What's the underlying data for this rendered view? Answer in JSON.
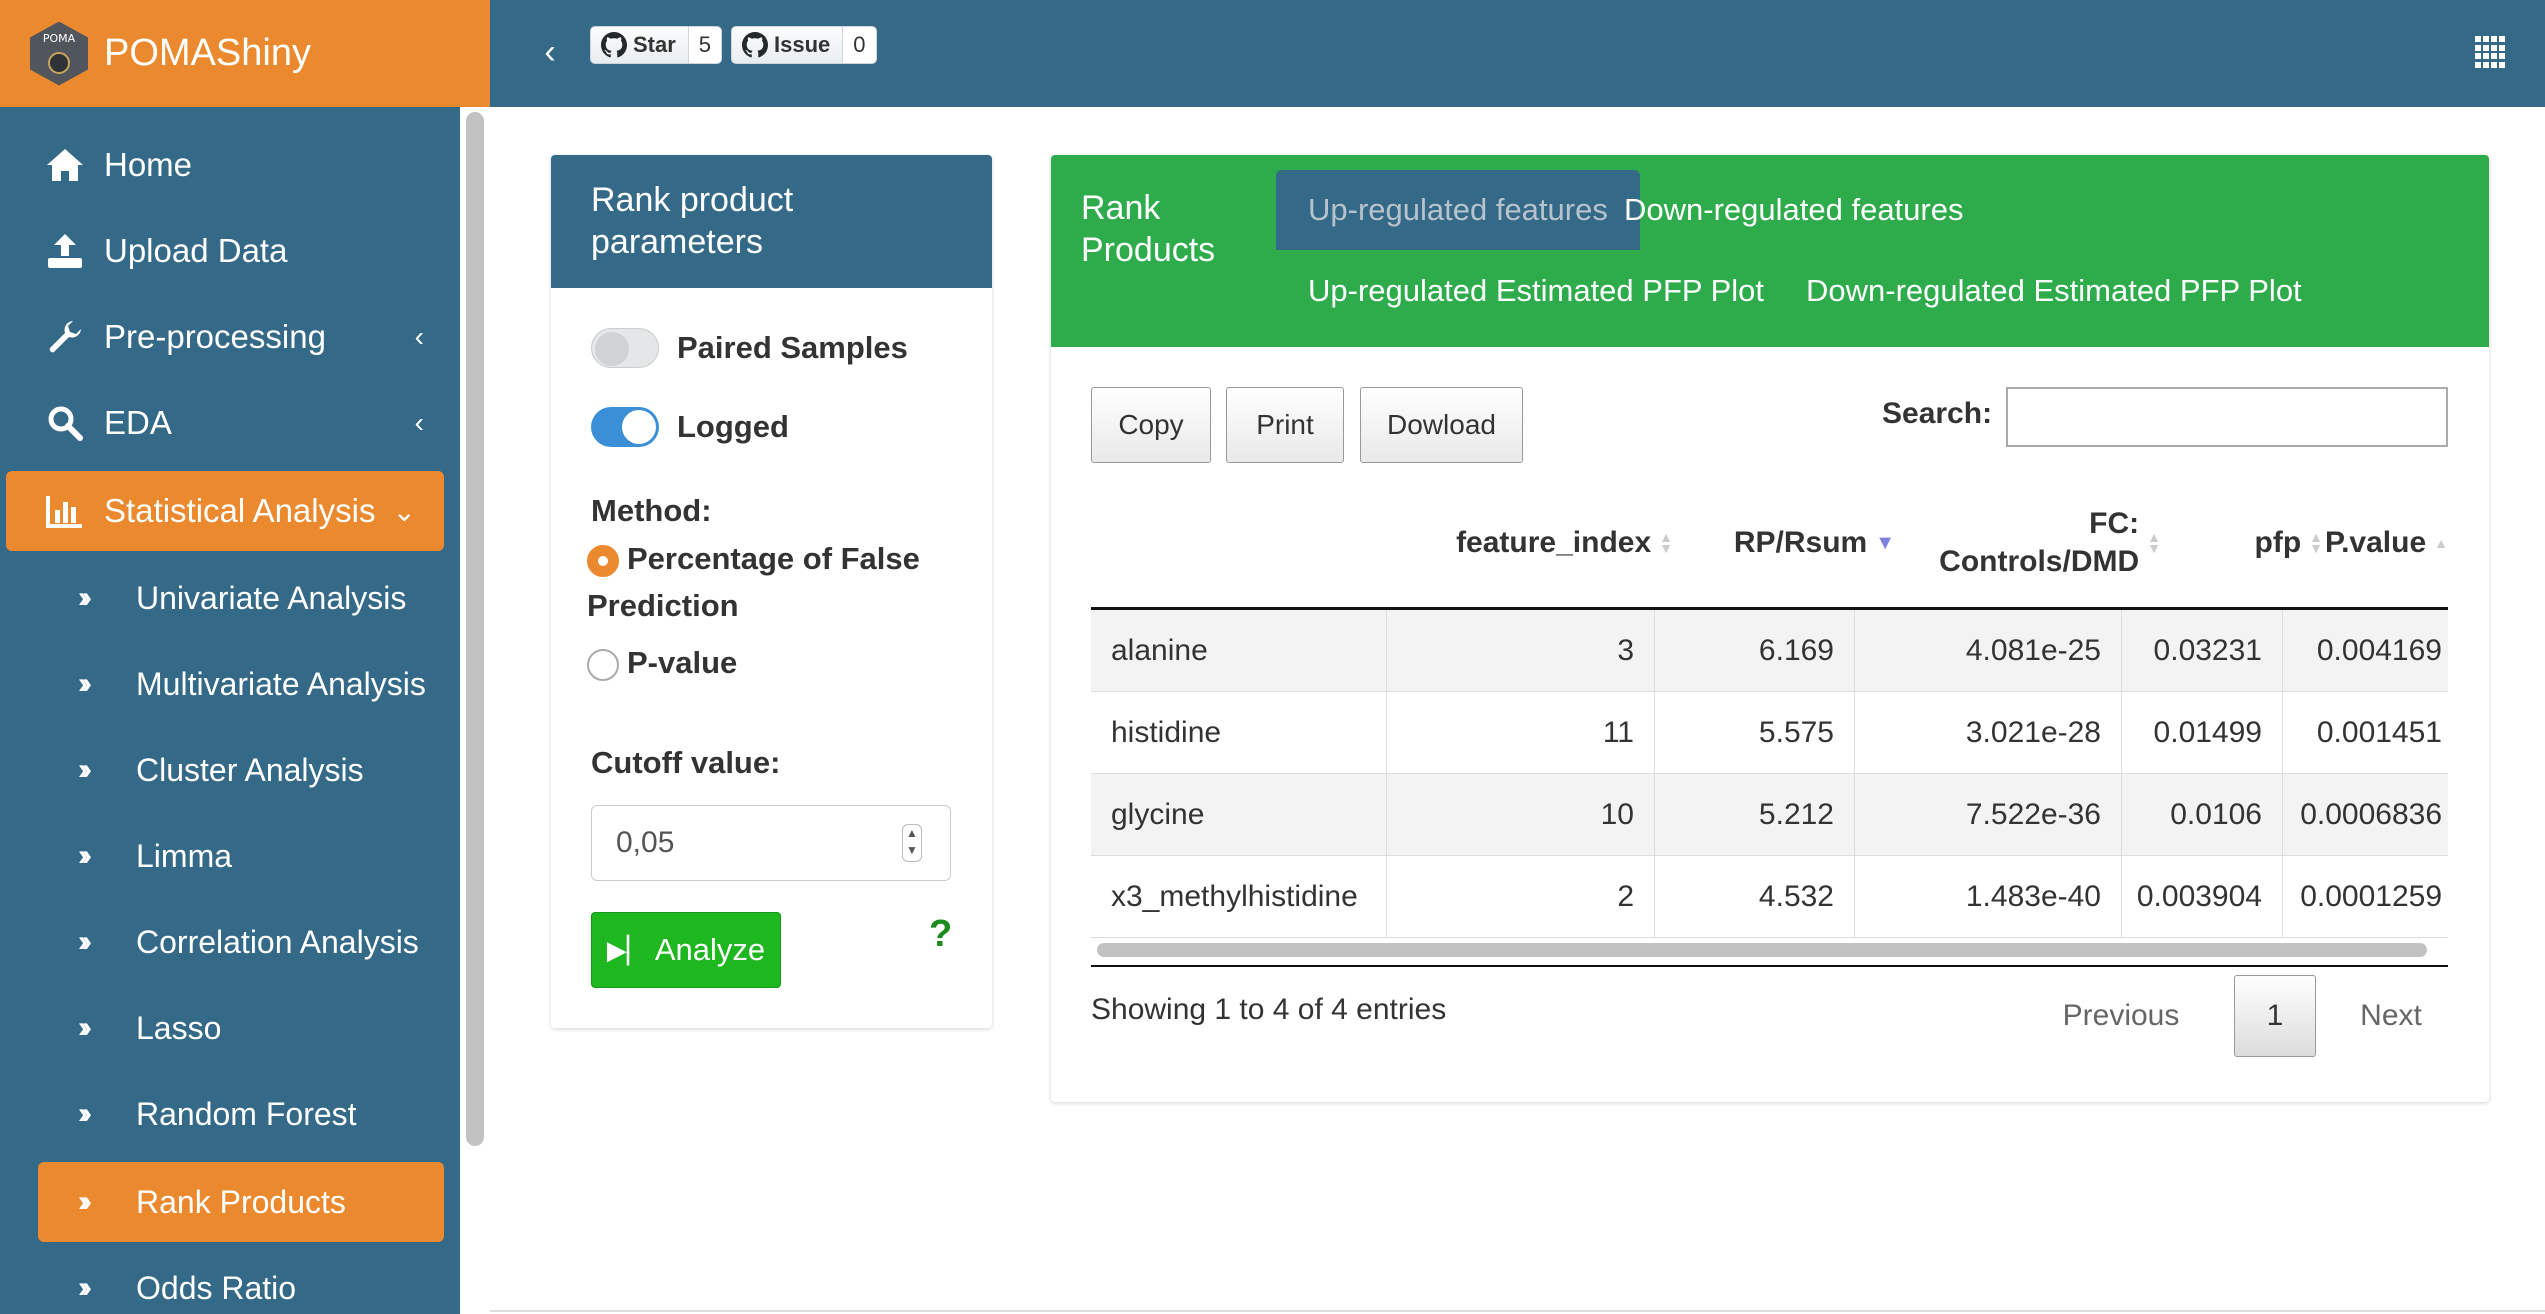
{
  "header": {
    "app_name": "POMAShiny",
    "logo_text": "POMA",
    "github_star_label": "Star",
    "github_star_count": "5",
    "github_issue_label": "Issue",
    "github_issue_count": "0",
    "colors": {
      "header": "#346987",
      "brand": "#eb892f"
    }
  },
  "sidebar": {
    "items": [
      {
        "label": "Home",
        "icon": "home-icon"
      },
      {
        "label": "Upload Data",
        "icon": "upload-icon"
      },
      {
        "label": "Pre-processing",
        "icon": "wrench-icon"
      },
      {
        "label": "EDA",
        "icon": "search-icon"
      },
      {
        "label": "Statistical Analysis",
        "icon": "bar-chart-icon"
      }
    ],
    "subitems": [
      {
        "label": "Univariate Analysis"
      },
      {
        "label": "Multivariate Analysis"
      },
      {
        "label": "Cluster Analysis"
      },
      {
        "label": "Limma"
      },
      {
        "label": "Correlation Analysis"
      },
      {
        "label": "Lasso"
      },
      {
        "label": "Random Forest"
      },
      {
        "label": "Rank Products"
      },
      {
        "label": "Odds Ratio"
      }
    ]
  },
  "params": {
    "title": "Rank product parameters",
    "paired_label": "Paired Samples",
    "paired_on": false,
    "logged_label": "Logged",
    "logged_on": true,
    "method_label": "Method:",
    "method_option_1": "Percentage of False Prediction",
    "method_option_2": "P-value",
    "method_selected": "Percentage of False Prediction",
    "cutoff_label": "Cutoff value:",
    "cutoff_value": "0,05",
    "analyze_label": "Analyze",
    "help": "?"
  },
  "results": {
    "title": "Rank Products",
    "tabs": [
      {
        "label": "Up-regulated features",
        "active": true
      },
      {
        "label": "Down-regulated features",
        "active": false
      },
      {
        "label": "Up-regulated Estimated PFP Plot",
        "active": false
      },
      {
        "label": "Down-regulated Estimated PFP Plot",
        "active": false
      }
    ],
    "buttons": {
      "copy": "Copy",
      "print": "Print",
      "download": "Dowload"
    },
    "search_label": "Search:",
    "columns": [
      "",
      "feature_index",
      "RP/Rsum",
      "FC: Controls/DMD",
      "pfp",
      "P.value"
    ],
    "rows": [
      [
        "alanine",
        "3",
        "6.169",
        "4.081e-25",
        "0.03231",
        "0.004169"
      ],
      [
        "histidine",
        "11",
        "5.575",
        "3.021e-28",
        "0.01499",
        "0.001451"
      ],
      [
        "glycine",
        "10",
        "5.212",
        "7.522e-36",
        "0.0106",
        "0.0006836"
      ],
      [
        "x3_methylhistidine",
        "2",
        "4.532",
        "1.483e-40",
        "0.003904",
        "0.0001259"
      ]
    ],
    "info": "Showing 1 to 4 of 4 entries",
    "pagination": {
      "previous": "Previous",
      "current": "1",
      "next": "Next"
    },
    "colors": {
      "header": "#2eab4b"
    }
  }
}
